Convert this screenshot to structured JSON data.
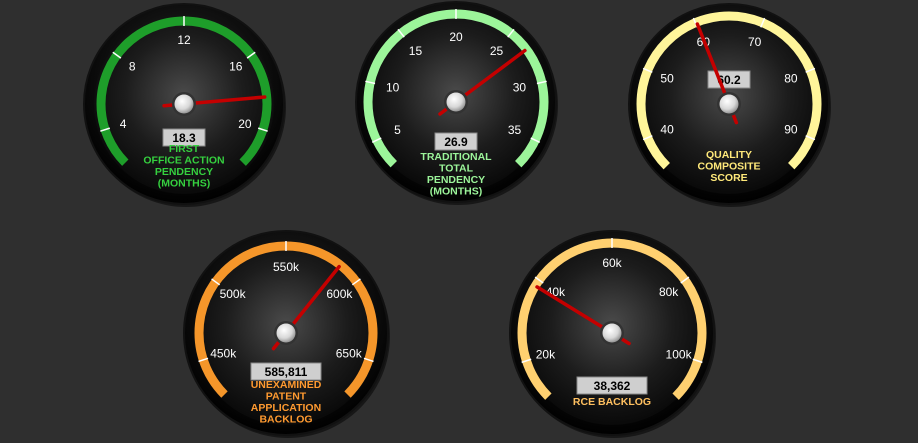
{
  "gauges": [
    {
      "id": "first-action-pendency",
      "value": 18.3,
      "value_text": "18.3",
      "min": 2,
      "max": 22,
      "ticks": [
        4,
        8,
        12,
        16,
        20
      ],
      "tick_labels": [
        "4",
        "8",
        "12",
        "16",
        "20"
      ],
      "label_lines": [
        "FIRST",
        "OFFICE ACTION",
        "PENDENCY",
        "(MONTHS)"
      ],
      "color": "#1e9e2a",
      "label_color": "#35d03f"
    },
    {
      "id": "traditional-total-pendency",
      "value": 26.9,
      "value_text": "26.9",
      "min": 2.5,
      "max": 37.5,
      "ticks": [
        5,
        10,
        15,
        20,
        25,
        30,
        35
      ],
      "tick_labels": [
        "5",
        "10",
        "15",
        "20",
        "25",
        "30",
        "35"
      ],
      "label_lines": [
        "TRADITIONAL",
        "TOTAL",
        "PENDENCY",
        "(MONTHS)"
      ],
      "color": "#9cf59a",
      "label_color": "#9cf59a"
    },
    {
      "id": "quality-composite-score",
      "value": 60.2,
      "value_text": "60.2",
      "min": 35,
      "max": 95,
      "ticks": [
        40,
        50,
        60,
        70,
        80,
        90
      ],
      "tick_labels": [
        "40",
        "50",
        "60",
        "70",
        "80",
        "90"
      ],
      "label_lines": [
        "QUALITY",
        "COMPOSITE",
        "SCORE"
      ],
      "color": "#fff59a",
      "label_color": "#ffe97a"
    },
    {
      "id": "unexamined-application-backlog",
      "value": 585811,
      "value_text": "585,811",
      "min": 425000,
      "max": 675000,
      "ticks": [
        450000,
        500000,
        550000,
        600000,
        650000
      ],
      "tick_labels": [
        "450k",
        "500k",
        "550k",
        "600k",
        "650k"
      ],
      "label_lines": [
        "UNEXAMINED",
        "PATENT",
        "APPLICATION",
        "BACKLOG"
      ],
      "color": "#f5962a",
      "label_color": "#ff9a30"
    },
    {
      "id": "rce-backlog",
      "value": 38362,
      "value_text": "38,362",
      "min": 10000,
      "max": 110000,
      "ticks": [
        20000,
        40000,
        60000,
        80000,
        100000
      ],
      "tick_labels": [
        "20k",
        "40k",
        "60k",
        "80k",
        "100k"
      ],
      "label_lines": [
        "RCE BACKLOG"
      ],
      "color": "#ffd070",
      "label_color": "#ffc060"
    }
  ],
  "colors": {
    "background": "#2f2f2f",
    "needle": "#c40000",
    "value_box": "#cfcfcf"
  }
}
